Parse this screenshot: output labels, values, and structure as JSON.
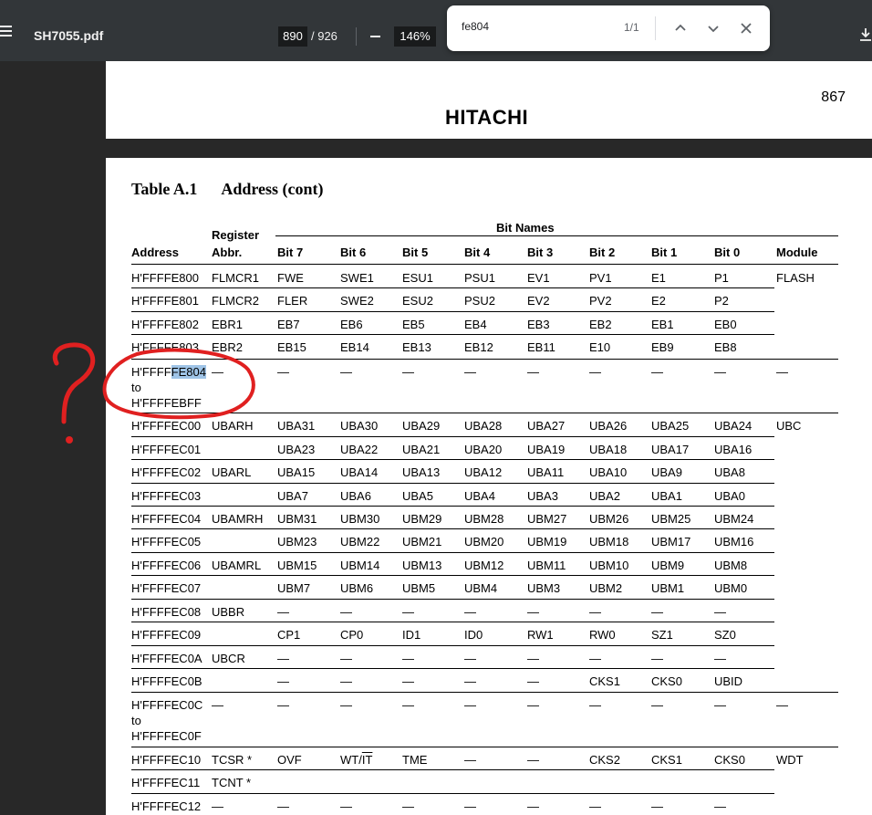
{
  "toolbar": {
    "menu_icon": "hamburger-icon",
    "filename": "SH7055.pdf",
    "page_current": "890",
    "page_total": "/ 926",
    "zoom": "146%",
    "download_icon": "download-icon"
  },
  "findbar": {
    "query": "fe804",
    "count": "1/1"
  },
  "prev_page": {
    "page_number": "867",
    "footer_brand": "HITACHI"
  },
  "table": {
    "title_num": "Table A.1",
    "title_text": "Address (cont)",
    "headers": {
      "register": "Register",
      "abbr": "Abbr.",
      "bit_names": "Bit Names",
      "address": "Address",
      "bits": [
        "Bit 7",
        "Bit 6",
        "Bit 5",
        "Bit 4",
        "Bit 3",
        "Bit 2",
        "Bit 1",
        "Bit 0"
      ],
      "module": "Module"
    },
    "rows": [
      {
        "addr": [
          "H'FFFFE800"
        ],
        "abbr": "FLMCR1",
        "bits": [
          "FWE",
          "SWE1",
          "ESU1",
          "PSU1",
          "EV1",
          "PV1",
          "E1",
          "P1"
        ],
        "module": "FLASH"
      },
      {
        "addr": [
          "H'FFFFE801"
        ],
        "abbr": "FLMCR2",
        "bits": [
          "FLER",
          "SWE2",
          "ESU2",
          "PSU2",
          "EV2",
          "PV2",
          "E2",
          "P2"
        ],
        "module": ""
      },
      {
        "addr": [
          "H'FFFFE802"
        ],
        "abbr": "EBR1",
        "bits": [
          "EB7",
          "EB6",
          "EB5",
          "EB4",
          "EB3",
          "EB2",
          "EB1",
          "EB0"
        ],
        "module": ""
      },
      {
        "addr": [
          "H'FFFFE803"
        ],
        "abbr": "EBR2",
        "bits": [
          "EB15",
          "EB14",
          "EB13",
          "EB12",
          "EB11",
          "E10",
          "EB9",
          "EB8"
        ],
        "module": ""
      },
      {
        "addr_pre": "H'FFFF",
        "addr_hl": "FE804",
        "addr_rest": [
          "to",
          "H'FFFFEBFF"
        ],
        "abbr": "—",
        "bits": [
          "—",
          "—",
          "—",
          "—",
          "—",
          "—",
          "—",
          "—"
        ],
        "module": "—"
      },
      {
        "addr": [
          "H'FFFFEC00"
        ],
        "abbr": "UBARH",
        "bits": [
          "UBA31",
          "UBA30",
          "UBA29",
          "UBA28",
          "UBA27",
          "UBA26",
          "UBA25",
          "UBA24"
        ],
        "module": "UBC"
      },
      {
        "addr": [
          "H'FFFFEC01"
        ],
        "abbr": "",
        "bits": [
          "UBA23",
          "UBA22",
          "UBA21",
          "UBA20",
          "UBA19",
          "UBA18",
          "UBA17",
          "UBA16"
        ],
        "module": ""
      },
      {
        "addr": [
          "H'FFFFEC02"
        ],
        "abbr": "UBARL",
        "bits": [
          "UBA15",
          "UBA14",
          "UBA13",
          "UBA12",
          "UBA11",
          "UBA10",
          "UBA9",
          "UBA8"
        ],
        "module": ""
      },
      {
        "addr": [
          "H'FFFFEC03"
        ],
        "abbr": "",
        "bits": [
          "UBA7",
          "UBA6",
          "UBA5",
          "UBA4",
          "UBA3",
          "UBA2",
          "UBA1",
          "UBA0"
        ],
        "module": ""
      },
      {
        "addr": [
          "H'FFFFEC04"
        ],
        "abbr": "UBAMRH",
        "bits": [
          "UBM31",
          "UBM30",
          "UBM29",
          "UBM28",
          "UBM27",
          "UBM26",
          "UBM25",
          "UBM24"
        ],
        "module": ""
      },
      {
        "addr": [
          "H'FFFFEC05"
        ],
        "abbr": "",
        "bits": [
          "UBM23",
          "UBM22",
          "UBM21",
          "UBM20",
          "UBM19",
          "UBM18",
          "UBM17",
          "UBM16"
        ],
        "module": ""
      },
      {
        "addr": [
          "H'FFFFEC06"
        ],
        "abbr": "UBAMRL",
        "bits": [
          "UBM15",
          "UBM14",
          "UBM13",
          "UBM12",
          "UBM11",
          "UBM10",
          "UBM9",
          "UBM8"
        ],
        "module": ""
      },
      {
        "addr": [
          "H'FFFFEC07"
        ],
        "abbr": "",
        "bits": [
          "UBM7",
          "UBM6",
          "UBM5",
          "UBM4",
          "UBM3",
          "UBM2",
          "UBM1",
          "UBM0"
        ],
        "module": ""
      },
      {
        "addr": [
          "H'FFFFEC08"
        ],
        "abbr": "UBBR",
        "bits": [
          "—",
          "—",
          "—",
          "—",
          "—",
          "—",
          "—",
          "—"
        ],
        "module": ""
      },
      {
        "addr": [
          "H'FFFFEC09"
        ],
        "abbr": "",
        "bits": [
          "CP1",
          "CP0",
          "ID1",
          "ID0",
          "RW1",
          "RW0",
          "SZ1",
          "SZ0"
        ],
        "module": ""
      },
      {
        "addr": [
          "H'FFFFEC0A"
        ],
        "abbr": "UBCR",
        "bits": [
          "—",
          "—",
          "—",
          "—",
          "—",
          "—",
          "—",
          "—"
        ],
        "module": ""
      },
      {
        "addr": [
          "H'FFFFEC0B"
        ],
        "abbr": "",
        "bits": [
          "—",
          "—",
          "—",
          "—",
          "—",
          "CKS1",
          "CKS0",
          "UBID"
        ],
        "module": ""
      },
      {
        "addr": [
          "H'FFFFEC0C",
          "to",
          "H'FFFFEC0F"
        ],
        "abbr": "—",
        "bits": [
          "—",
          "—",
          "—",
          "—",
          "—",
          "—",
          "—",
          "—"
        ],
        "module": "—"
      },
      {
        "addr": [
          "H'FFFFEC10"
        ],
        "abbr": "TCSR *",
        "bits": [
          "OVF",
          "WT/IT",
          "TME",
          "—",
          "—",
          "CKS2",
          "CKS1",
          "CKS0"
        ],
        "module": "WDT"
      },
      {
        "addr": [
          "H'FFFFEC11"
        ],
        "abbr": "TCNT *",
        "bits": [
          "",
          "",
          "",
          "",
          "",
          "",
          "",
          ""
        ],
        "module": ""
      },
      {
        "addr": [
          "H'FFFFEC12"
        ],
        "abbr": "—",
        "bits": [
          "—",
          "—",
          "—",
          "—",
          "—",
          "—",
          "—",
          "—"
        ],
        "module": ""
      }
    ]
  },
  "annotation": {
    "mark": "?",
    "color": "#e02020"
  }
}
